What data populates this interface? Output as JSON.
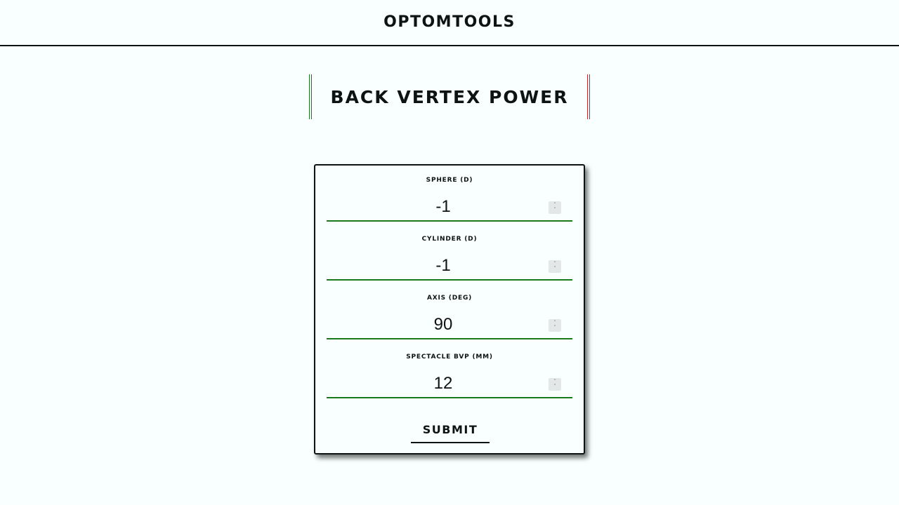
{
  "header": {
    "brand": "OPTOMTOOLS"
  },
  "page": {
    "title": "BACK VERTEX POWER"
  },
  "form": {
    "fields": [
      {
        "label": "SPHERE (D)",
        "value": "-1"
      },
      {
        "label": "CYLINDER (D)",
        "value": "-1"
      },
      {
        "label": "AXIS (DEG)",
        "value": "90"
      },
      {
        "label": "SPECTACLE BVP (MM)",
        "value": "12"
      }
    ],
    "submit_label": "SUBMIT"
  },
  "colors": {
    "background": "#f8fffe",
    "text": "#0b1412",
    "accent_green": "#1a7a1a",
    "accent_red": "#c0282d"
  }
}
